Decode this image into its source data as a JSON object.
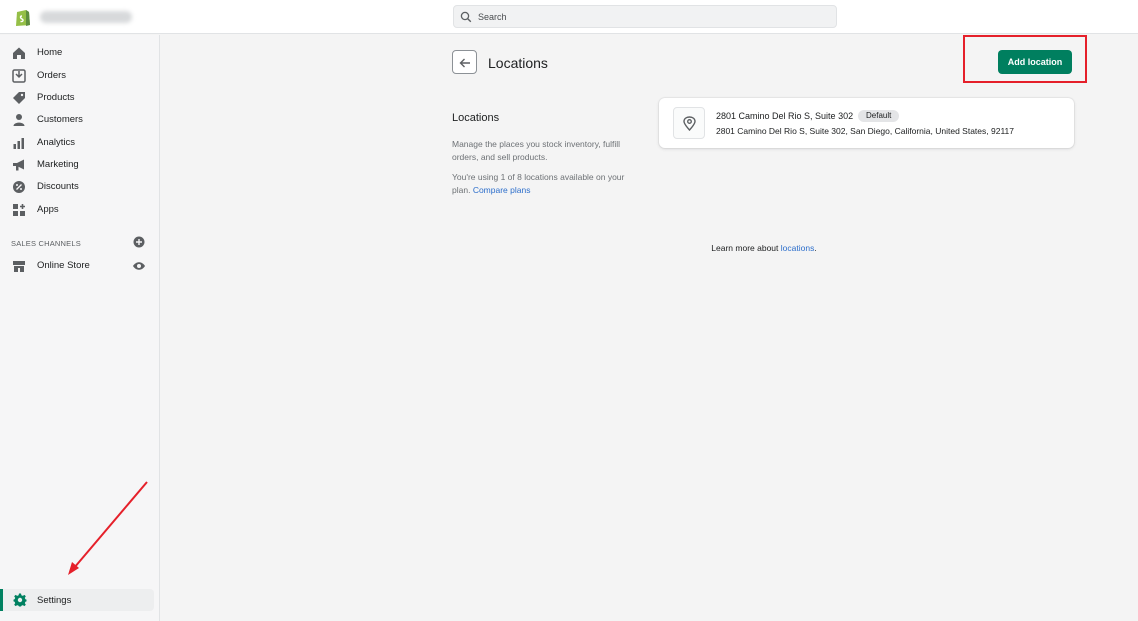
{
  "topbar": {
    "search_placeholder": "Search"
  },
  "sidebar": {
    "items": [
      {
        "label": "Home",
        "icon": "home-icon"
      },
      {
        "label": "Orders",
        "icon": "orders-icon"
      },
      {
        "label": "Products",
        "icon": "tag-icon"
      },
      {
        "label": "Customers",
        "icon": "person-icon"
      },
      {
        "label": "Analytics",
        "icon": "bar-chart-icon"
      },
      {
        "label": "Marketing",
        "icon": "megaphone-icon"
      },
      {
        "label": "Discounts",
        "icon": "discount-icon"
      },
      {
        "label": "Apps",
        "icon": "apps-icon"
      }
    ],
    "sales_channels_title": "SALES CHANNELS",
    "online_store_label": "Online Store",
    "settings_label": "Settings"
  },
  "header": {
    "title": "Locations",
    "add_button": "Add location"
  },
  "locations_section": {
    "heading": "Locations",
    "description": "Manage the places you stock inventory, fulfill orders, and sell products.",
    "plan_text": "You're using 1 of 8 locations available on your plan.",
    "compare_link": "Compare plans"
  },
  "location_card": {
    "name": "2801 Camino Del Rio S, Suite 302",
    "badge": "Default",
    "address": "2801 Camino Del Rio S, Suite 302, San Diego, California, United States, 92117"
  },
  "footer": {
    "learn_text": "Learn more about",
    "learn_link": "locations",
    "learn_suffix": "."
  },
  "colors": {
    "accent": "#008060",
    "annotation_red": "#e5202a",
    "link": "#2c6ecb"
  }
}
